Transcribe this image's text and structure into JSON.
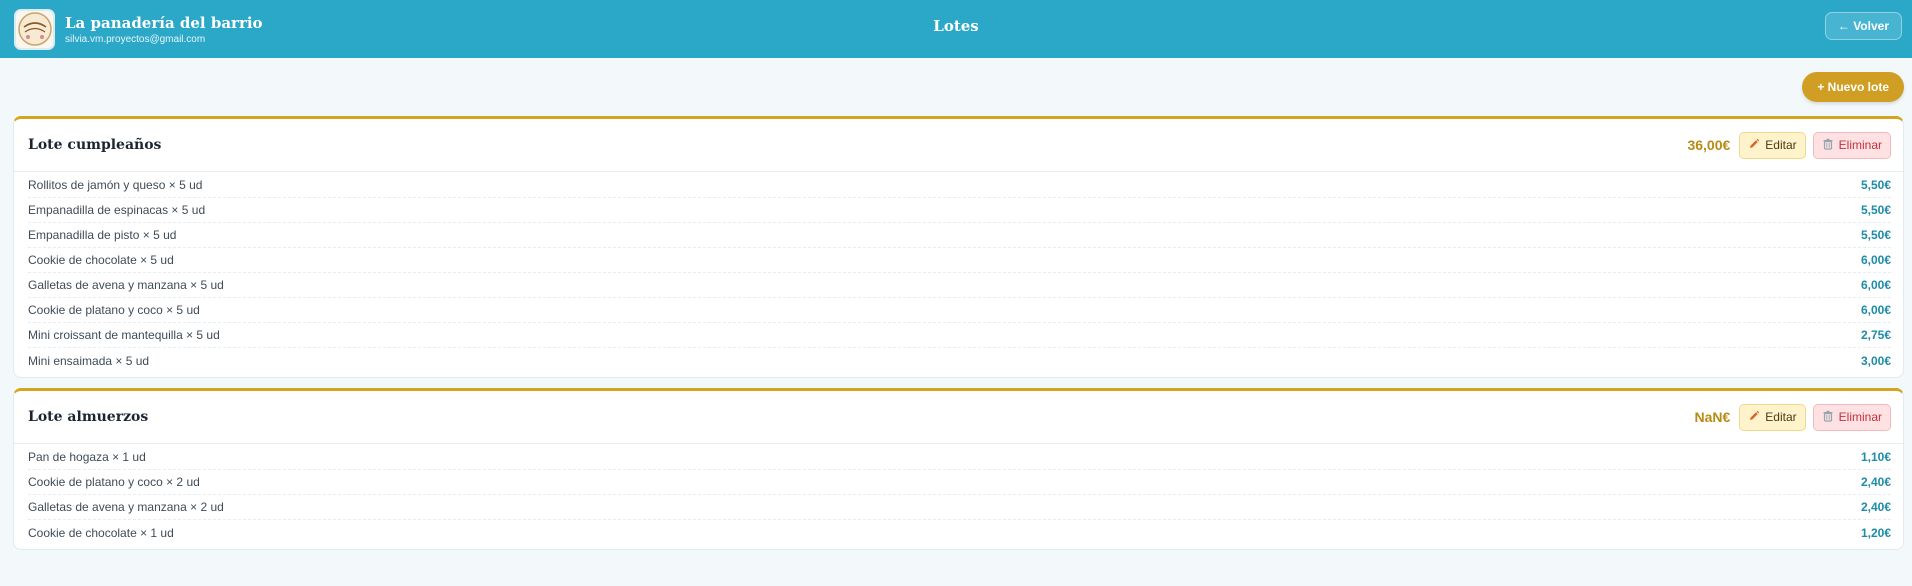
{
  "header": {
    "app_name": "La panadería del barrio",
    "email": "silvia.vm.proyectos@gmail.com",
    "page_title": "Lotes",
    "back_label": "← Volver",
    "logo_icon": "bakery-logo"
  },
  "toolbar": {
    "new_label": "+ Nuevo lote"
  },
  "colors": {
    "topbar": "#2ba8c8",
    "accent_gold": "#d3a51f",
    "price_blue": "#1e8ba8",
    "delete_red": "#c3323f"
  },
  "lotes": [
    {
      "name": "Lote cumpleaños",
      "total": "36,00€",
      "edit_label": "Editar",
      "delete_label": "Eliminar",
      "items": [
        {
          "name": "Rollitos de jamón y queso × 5 ud",
          "price": "5,50€"
        },
        {
          "name": "Empanadilla de espinacas × 5 ud",
          "price": "5,50€"
        },
        {
          "name": "Empanadilla de pisto × 5 ud",
          "price": "5,50€"
        },
        {
          "name": "Cookie de chocolate × 5 ud",
          "price": "6,00€"
        },
        {
          "name": "Galletas de avena y manzana × 5 ud",
          "price": "6,00€"
        },
        {
          "name": "Cookie de platano y coco × 5 ud",
          "price": "6,00€"
        },
        {
          "name": "Mini croissant de mantequilla × 5 ud",
          "price": "2,75€"
        },
        {
          "name": "Mini ensaimada × 5 ud",
          "price": "3,00€"
        }
      ]
    },
    {
      "name": "Lote almuerzos",
      "total": "NaN€",
      "edit_label": "Editar",
      "delete_label": "Eliminar",
      "items": [
        {
          "name": "Pan de hogaza × 1 ud",
          "price": "1,10€"
        },
        {
          "name": "Cookie de platano y coco × 2 ud",
          "price": "2,40€"
        },
        {
          "name": "Galletas de avena y manzana × 2 ud",
          "price": "2,40€"
        },
        {
          "name": "Cookie de chocolate × 1 ud",
          "price": "1,20€"
        }
      ]
    }
  ]
}
